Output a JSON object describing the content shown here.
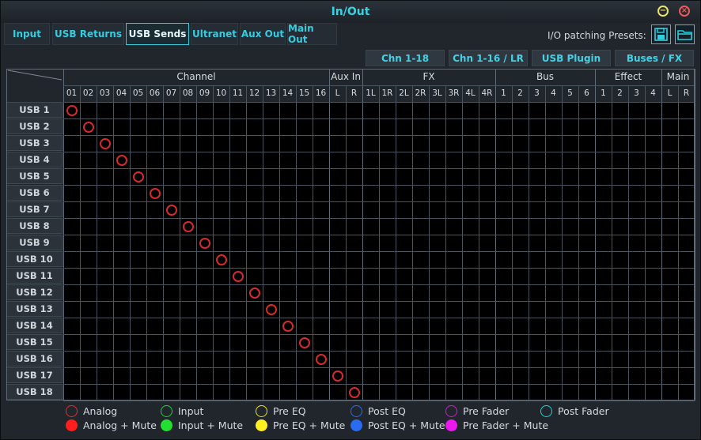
{
  "window": {
    "title": "In/Out",
    "minimize_glyph": "−",
    "close_glyph": "×"
  },
  "tabs": [
    {
      "label": "Input",
      "active": false
    },
    {
      "label": "USB Returns",
      "active": false
    },
    {
      "label": "USB Sends",
      "active": true
    },
    {
      "label": "Ultranet",
      "active": false
    },
    {
      "label": "Aux Out",
      "active": false
    },
    {
      "label": "Main Out",
      "active": false
    }
  ],
  "presets": {
    "label": "I/O patching Presets:",
    "save_icon": "floppy-disk-icon",
    "open_icon": "folder-icon"
  },
  "subtabs": [
    "Chn 1-18",
    "Chn 1-16 / LR",
    "USB Plugin",
    "Buses / FX"
  ],
  "groups": [
    {
      "label": "Channel",
      "count": 16
    },
    {
      "label": "Aux In",
      "count": 2
    },
    {
      "label": "FX",
      "count": 8
    },
    {
      "label": "Bus",
      "count": 6
    },
    {
      "label": "Effect",
      "count": 4
    },
    {
      "label": "Main",
      "count": 2
    }
  ],
  "columns": [
    "01",
    "02",
    "03",
    "04",
    "05",
    "06",
    "07",
    "08",
    "09",
    "10",
    "11",
    "12",
    "13",
    "14",
    "15",
    "16",
    "L",
    "R",
    "1L",
    "1R",
    "2L",
    "2R",
    "3L",
    "3R",
    "4L",
    "4R",
    "1",
    "2",
    "3",
    "4",
    "5",
    "6",
    "1",
    "2",
    "3",
    "4",
    "L",
    "R"
  ],
  "rows": [
    "USB 1",
    "USB 2",
    "USB 3",
    "USB 4",
    "USB 5",
    "USB 6",
    "USB 7",
    "USB 8",
    "USB 9",
    "USB 10",
    "USB 11",
    "USB 12",
    "USB 13",
    "USB 14",
    "USB 15",
    "USB 16",
    "USB 17",
    "USB 18"
  ],
  "patches": [
    {
      "row": 0,
      "col": 0,
      "type": "analog"
    },
    {
      "row": 1,
      "col": 1,
      "type": "analog"
    },
    {
      "row": 2,
      "col": 2,
      "type": "analog"
    },
    {
      "row": 3,
      "col": 3,
      "type": "analog"
    },
    {
      "row": 4,
      "col": 4,
      "type": "analog"
    },
    {
      "row": 5,
      "col": 5,
      "type": "analog"
    },
    {
      "row": 6,
      "col": 6,
      "type": "analog"
    },
    {
      "row": 7,
      "col": 7,
      "type": "analog"
    },
    {
      "row": 8,
      "col": 8,
      "type": "analog"
    },
    {
      "row": 9,
      "col": 9,
      "type": "analog"
    },
    {
      "row": 10,
      "col": 10,
      "type": "analog"
    },
    {
      "row": 11,
      "col": 11,
      "type": "analog"
    },
    {
      "row": 12,
      "col": 12,
      "type": "analog"
    },
    {
      "row": 13,
      "col": 13,
      "type": "analog"
    },
    {
      "row": 14,
      "col": 14,
      "type": "analog"
    },
    {
      "row": 15,
      "col": 15,
      "type": "analog"
    },
    {
      "row": 16,
      "col": 16,
      "type": "analog"
    },
    {
      "row": 17,
      "col": 17,
      "type": "analog"
    }
  ],
  "legend": [
    {
      "label": "Analog",
      "color": "#e03030",
      "filled": false
    },
    {
      "label": "Input",
      "color": "#22d232",
      "filled": false
    },
    {
      "label": "Pre EQ",
      "color": "#e8e020",
      "filled": false
    },
    {
      "label": "Post EQ",
      "color": "#2a6cf0",
      "filled": false
    },
    {
      "label": "Pre Fader",
      "color": "#d21ad2",
      "filled": false
    },
    {
      "label": "Post Fader",
      "color": "#20d2d2",
      "filled": false
    },
    {
      "label": "Analog + Mute",
      "color": "#ff1e1e",
      "filled": true
    },
    {
      "label": "Input + Mute",
      "color": "#22e032",
      "filled": true
    },
    {
      "label": "Pre EQ + Mute",
      "color": "#ffee20",
      "filled": true
    },
    {
      "label": "Post EQ + Mute",
      "color": "#2a6cf0",
      "filled": true
    },
    {
      "label": "Pre Fader + Mute",
      "color": "#ee18ee",
      "filled": true
    }
  ],
  "patch_colors": {
    "analog": "#d62b2b"
  }
}
